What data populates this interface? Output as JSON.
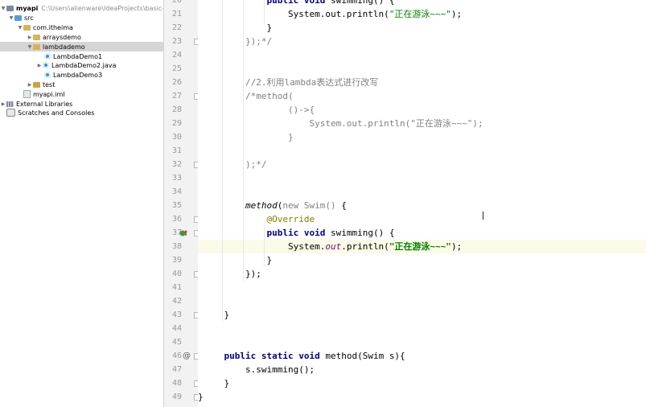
{
  "project_tree": {
    "items": [
      {
        "label": "myapi",
        "path": "C:\\Users\\alienware\\IdeaProjects\\basic-code\\m",
        "depth": 0,
        "expanded": true,
        "icon": "module-folder-icon",
        "bold": true
      },
      {
        "label": "src",
        "depth": 1,
        "expanded": true,
        "icon": "source-folder-icon"
      },
      {
        "label": "com.itheima",
        "depth": 2,
        "expanded": true,
        "icon": "package-icon"
      },
      {
        "label": "arraysdemo",
        "depth": 3,
        "expanded": false,
        "icon": "package-icon"
      },
      {
        "label": "lambdademo",
        "depth": 3,
        "expanded": true,
        "icon": "package-icon",
        "selected": true
      },
      {
        "label": "LambdaDemo1",
        "depth": 4,
        "icon": "java-class-icon"
      },
      {
        "label": "LambdaDemo2.java",
        "depth": 4,
        "expanded": false,
        "icon": "java-class-icon"
      },
      {
        "label": "LambdaDemo3",
        "depth": 4,
        "icon": "java-class-icon"
      },
      {
        "label": "test",
        "depth": 3,
        "expanded": false,
        "icon": "folder-icon"
      },
      {
        "label": "myapi.iml",
        "depth": 2,
        "icon": "file-icon"
      },
      {
        "label": "External Libraries",
        "depth": 0,
        "expanded": false,
        "icon": "library-icon"
      },
      {
        "label": "Scratches and Consoles",
        "depth": 0,
        "icon": "scratch-icon"
      }
    ]
  },
  "editor": {
    "highlighted_line": 38,
    "lines": [
      {
        "n": "20",
        "text": "            public void swimming() {"
      },
      {
        "n": "21",
        "text": "                System.out.println(\"正在游泳~~~\");"
      },
      {
        "n": "22",
        "text": "            }"
      },
      {
        "n": "23",
        "text": "        });*/"
      },
      {
        "n": "24",
        "text": ""
      },
      {
        "n": "25",
        "text": ""
      },
      {
        "n": "26",
        "text": "        //2.利用lambda表达式进行改写"
      },
      {
        "n": "27",
        "text": "        /*method("
      },
      {
        "n": "28",
        "text": "                ()->{"
      },
      {
        "n": "29",
        "text": "                    System.out.println(\"正在游泳~~~\");"
      },
      {
        "n": "30",
        "text": "                }"
      },
      {
        "n": "31",
        "text": ""
      },
      {
        "n": "32",
        "text": "        );*/"
      },
      {
        "n": "33",
        "text": ""
      },
      {
        "n": "34",
        "text": ""
      },
      {
        "n": "35",
        "text": "        method(new Swim() {"
      },
      {
        "n": "36",
        "text": "            @Override"
      },
      {
        "n": "37",
        "text": "            public void swimming() {"
      },
      {
        "n": "38",
        "text": "                System.out.println(\"正在游泳~~~\");"
      },
      {
        "n": "39",
        "text": "            }"
      },
      {
        "n": "40",
        "text": "        });"
      },
      {
        "n": "41",
        "text": ""
      },
      {
        "n": "42",
        "text": ""
      },
      {
        "n": "43",
        "text": "    }"
      },
      {
        "n": "44",
        "text": ""
      },
      {
        "n": "45",
        "text": ""
      },
      {
        "n": "46",
        "text": "    public static void method(Swim s){"
      },
      {
        "n": "47",
        "text": "        s.swimming();"
      },
      {
        "n": "48",
        "text": "    }"
      },
      {
        "n": "49",
        "text": "}"
      }
    ]
  },
  "gutter_markers": {
    "line37": "implementing-method-icon",
    "line46": "@"
  },
  "colors": {
    "keyword": "#000080",
    "comment": "#808080",
    "string": "#008000",
    "annotation": "#808000",
    "field": "#660e7a",
    "highlight": "#fcfae8",
    "selection": "#d5d5d5"
  }
}
